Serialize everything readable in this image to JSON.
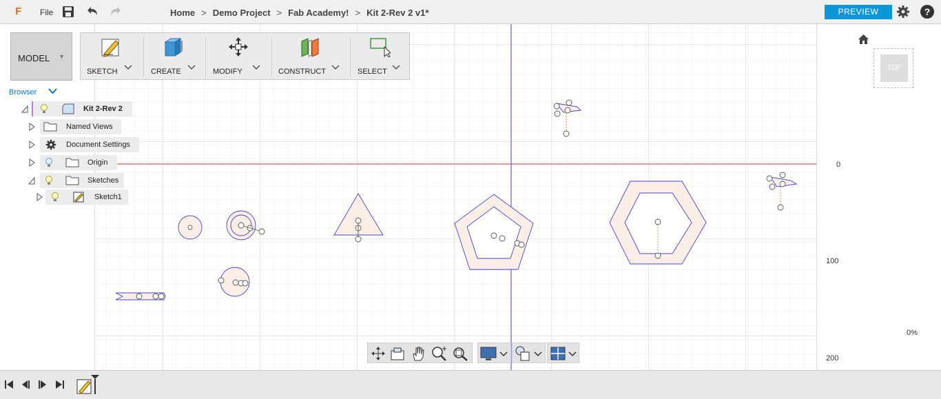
{
  "app": {
    "logo": "F",
    "file_menu": "File"
  },
  "breadcrumb": {
    "items": [
      "Home",
      "Demo Project",
      "Fab Academy!",
      "Kit 2-Rev 2 v1*"
    ],
    "separator": ">"
  },
  "header": {
    "preview_label": "PREVIEW",
    "help_label": "?"
  },
  "workspace": {
    "model_label": "MODEL"
  },
  "toolbar": {
    "tools": [
      {
        "label": "SKETCH",
        "icon": "sketch-pencil-icon"
      },
      {
        "label": "CREATE",
        "icon": "create-box-icon"
      },
      {
        "label": "MODIFY",
        "icon": "modify-move-arrows-icon"
      },
      {
        "label": "CONSTRUCT",
        "icon": "construct-planes-icon"
      },
      {
        "label": "SELECT",
        "icon": "select-cursor-icon"
      }
    ]
  },
  "browser": {
    "title": "Browser",
    "items": [
      {
        "label": "Kit 2-Rev 2"
      },
      {
        "label": "Named Views"
      },
      {
        "label": "Document Settings"
      },
      {
        "label": "Origin"
      },
      {
        "label": "Sketches"
      },
      {
        "label": "Sketch1"
      }
    ]
  },
  "viewcube": {
    "face_label": "TOP"
  },
  "ruler": {
    "labels": [
      "0",
      "100",
      "200"
    ],
    "percent": "0%"
  },
  "colors": {
    "accent": "#0a96d8",
    "logo": "#f26b22",
    "sketch_line": "#3f3fd0",
    "axis_red": "#e03030",
    "axis_blue": "#3b3bd6",
    "profile_fill": "#fbeee6"
  },
  "canvas_tools": [
    "orbit-icon",
    "look-at-icon",
    "pan-hand-icon",
    "zoom-icon",
    "fit-icon",
    "display-settings-icon",
    "visual-style-icon",
    "grid-settings-icon"
  ]
}
